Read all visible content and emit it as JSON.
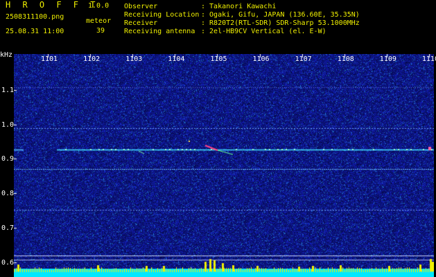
{
  "header": {
    "app_title": "H R O F F T",
    "version": "1.0.0",
    "file_name": "2508311100.png",
    "date_time": "25.08.31 11:00",
    "meteor_label": "meteor",
    "meteor_count": "39",
    "observer_label": "Observer",
    "observer_value": ": Takanori Kawachi",
    "location_label": "Receiving Location",
    "location_value": ": Ogaki, Gifu, JAPAN (136.60E, 35.35N)",
    "receiver_label": "Receiver",
    "receiver_value": ": R820T2(RTL-SDR) SDR-Sharp 53.1000MHz",
    "antenna_label": "Receiving antenna",
    "antenna_value": ": 2el-HB9CV Vertical (el. E-W)"
  },
  "axis": {
    "y_unit": "kHz",
    "x_ticks": [
      "1101",
      "1102",
      "1103",
      "1104",
      "1105",
      "1106",
      "1107",
      "1108",
      "1109",
      "1110"
    ],
    "y_ticks": [
      "1.1",
      "1.0",
      "0.9",
      "0.8",
      "0.7",
      "0.6"
    ]
  },
  "colors": {
    "background": "#000000",
    "header_text": "#f0f000",
    "spectrogram_bg": "#0a0f78",
    "signal_line": "#40e0ff",
    "baseline": "#00f0ff"
  }
}
